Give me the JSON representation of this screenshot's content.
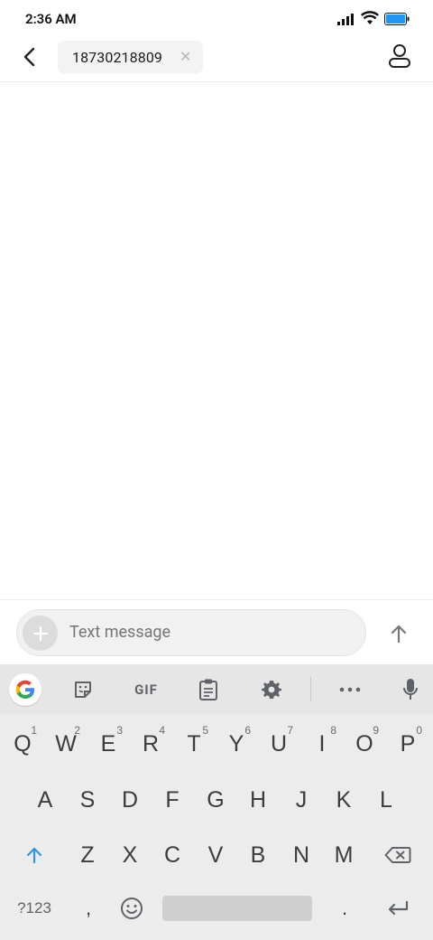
{
  "status_bar": {
    "time": "2:36 AM"
  },
  "header": {
    "recipient": "18730218809"
  },
  "compose": {
    "placeholder": "Text message"
  },
  "keyboard": {
    "toolbar": [
      "google-icon",
      "sticker-icon",
      "GIF",
      "clipboard-icon",
      "gear-icon",
      "more-icon",
      "mic-icon"
    ],
    "gif_label": "GIF",
    "row1": [
      {
        "key": "Q",
        "hint": "1"
      },
      {
        "key": "W",
        "hint": "2"
      },
      {
        "key": "E",
        "hint": "3"
      },
      {
        "key": "R",
        "hint": "4"
      },
      {
        "key": "T",
        "hint": "5"
      },
      {
        "key": "Y",
        "hint": "6"
      },
      {
        "key": "U",
        "hint": "7"
      },
      {
        "key": "I",
        "hint": "8"
      },
      {
        "key": "O",
        "hint": "9"
      },
      {
        "key": "P",
        "hint": "0"
      }
    ],
    "row2": [
      "A",
      "S",
      "D",
      "F",
      "G",
      "H",
      "J",
      "K",
      "L"
    ],
    "row3": [
      "Z",
      "X",
      "C",
      "V",
      "B",
      "N",
      "M"
    ],
    "row4": {
      "sym": "?123",
      "comma": ",",
      "period": "."
    }
  },
  "colors": {
    "accent_blue": "#1a73e8",
    "shift_blue": "#2f97e0",
    "battery_blue": "#2196f3"
  }
}
